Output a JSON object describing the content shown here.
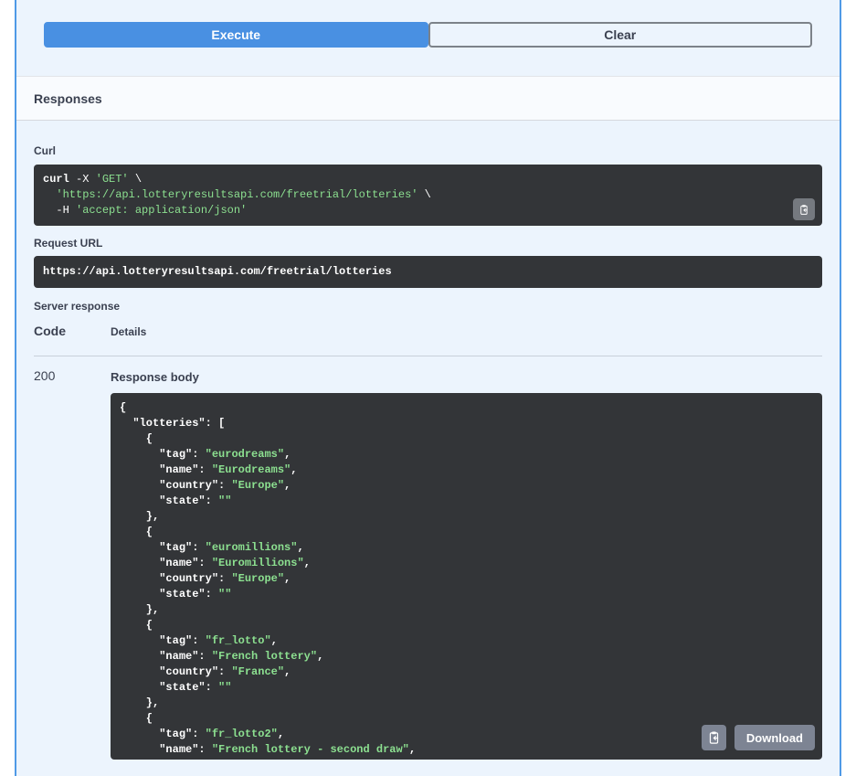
{
  "colors": {
    "accent_blue": "#4990e2",
    "opblock_border": "#4f9ae6",
    "opblock_bg": "#ecf4fd",
    "code_block_bg": "#333538",
    "string_green": "#8ce090",
    "gray_button": "#7d8493",
    "heading_text": "#3b4151"
  },
  "icons": {
    "copy": "clipboard-copy-icon"
  },
  "buttons": {
    "execute": "Execute",
    "clear": "Clear",
    "download": "Download"
  },
  "responses": {
    "title": "Responses"
  },
  "curl": {
    "label": "Curl",
    "lines": [
      [
        [
          "k",
          "curl"
        ],
        [
          "p",
          " -X "
        ],
        [
          "s",
          "'GET'"
        ],
        [
          "p",
          " \\"
        ]
      ],
      [
        [
          "p",
          "  "
        ],
        [
          "s",
          "'https://api.lotteryresultsapi.com/freetrial/lotteries'"
        ],
        [
          "p",
          " \\"
        ]
      ],
      [
        [
          "p",
          "  -H "
        ],
        [
          "s",
          "'accept: application/json'"
        ]
      ]
    ]
  },
  "request_url": {
    "label": "Request URL",
    "value": "https://api.lotteryresultsapi.com/freetrial/lotteries"
  },
  "server_response": {
    "label": "Server response",
    "code_header": "Code",
    "details_header": "Details",
    "status_code": "200",
    "response_body_label": "Response body",
    "body_lines": [
      [
        [
          "p",
          "{"
        ]
      ],
      [
        [
          "p",
          "  "
        ],
        [
          "k",
          "\"lotteries\":"
        ],
        [
          "p",
          " ["
        ]
      ],
      [
        [
          "p",
          "    {"
        ]
      ],
      [
        [
          "p",
          "      "
        ],
        [
          "k",
          "\"tag\":"
        ],
        [
          "p",
          " "
        ],
        [
          "s",
          "\"eurodreams\""
        ],
        [
          "p",
          ","
        ]
      ],
      [
        [
          "p",
          "      "
        ],
        [
          "k",
          "\"name\":"
        ],
        [
          "p",
          " "
        ],
        [
          "s",
          "\"Eurodreams\""
        ],
        [
          "p",
          ","
        ]
      ],
      [
        [
          "p",
          "      "
        ],
        [
          "k",
          "\"country\":"
        ],
        [
          "p",
          " "
        ],
        [
          "s",
          "\"Europe\""
        ],
        [
          "p",
          ","
        ]
      ],
      [
        [
          "p",
          "      "
        ],
        [
          "k",
          "\"state\":"
        ],
        [
          "p",
          " "
        ],
        [
          "s",
          "\"\""
        ]
      ],
      [
        [
          "p",
          "    },"
        ]
      ],
      [
        [
          "p",
          "    {"
        ]
      ],
      [
        [
          "p",
          "      "
        ],
        [
          "k",
          "\"tag\":"
        ],
        [
          "p",
          " "
        ],
        [
          "s",
          "\"euromillions\""
        ],
        [
          "p",
          ","
        ]
      ],
      [
        [
          "p",
          "      "
        ],
        [
          "k",
          "\"name\":"
        ],
        [
          "p",
          " "
        ],
        [
          "s",
          "\"Euromillions\""
        ],
        [
          "p",
          ","
        ]
      ],
      [
        [
          "p",
          "      "
        ],
        [
          "k",
          "\"country\":"
        ],
        [
          "p",
          " "
        ],
        [
          "s",
          "\"Europe\""
        ],
        [
          "p",
          ","
        ]
      ],
      [
        [
          "p",
          "      "
        ],
        [
          "k",
          "\"state\":"
        ],
        [
          "p",
          " "
        ],
        [
          "s",
          "\"\""
        ]
      ],
      [
        [
          "p",
          "    },"
        ]
      ],
      [
        [
          "p",
          "    {"
        ]
      ],
      [
        [
          "p",
          "      "
        ],
        [
          "k",
          "\"tag\":"
        ],
        [
          "p",
          " "
        ],
        [
          "s",
          "\"fr_lotto\""
        ],
        [
          "p",
          ","
        ]
      ],
      [
        [
          "p",
          "      "
        ],
        [
          "k",
          "\"name\":"
        ],
        [
          "p",
          " "
        ],
        [
          "s",
          "\"French lottery\""
        ],
        [
          "p",
          ","
        ]
      ],
      [
        [
          "p",
          "      "
        ],
        [
          "k",
          "\"country\":"
        ],
        [
          "p",
          " "
        ],
        [
          "s",
          "\"France\""
        ],
        [
          "p",
          ","
        ]
      ],
      [
        [
          "p",
          "      "
        ],
        [
          "k",
          "\"state\":"
        ],
        [
          "p",
          " "
        ],
        [
          "s",
          "\"\""
        ]
      ],
      [
        [
          "p",
          "    },"
        ]
      ],
      [
        [
          "p",
          "    {"
        ]
      ],
      [
        [
          "p",
          "      "
        ],
        [
          "k",
          "\"tag\":"
        ],
        [
          "p",
          " "
        ],
        [
          "s",
          "\"fr_lotto2\""
        ],
        [
          "p",
          ","
        ]
      ],
      [
        [
          "p",
          "      "
        ],
        [
          "k",
          "\"name\":"
        ],
        [
          "p",
          " "
        ],
        [
          "s",
          "\"French lottery - second draw\""
        ],
        [
          "p",
          ","
        ]
      ]
    ]
  }
}
